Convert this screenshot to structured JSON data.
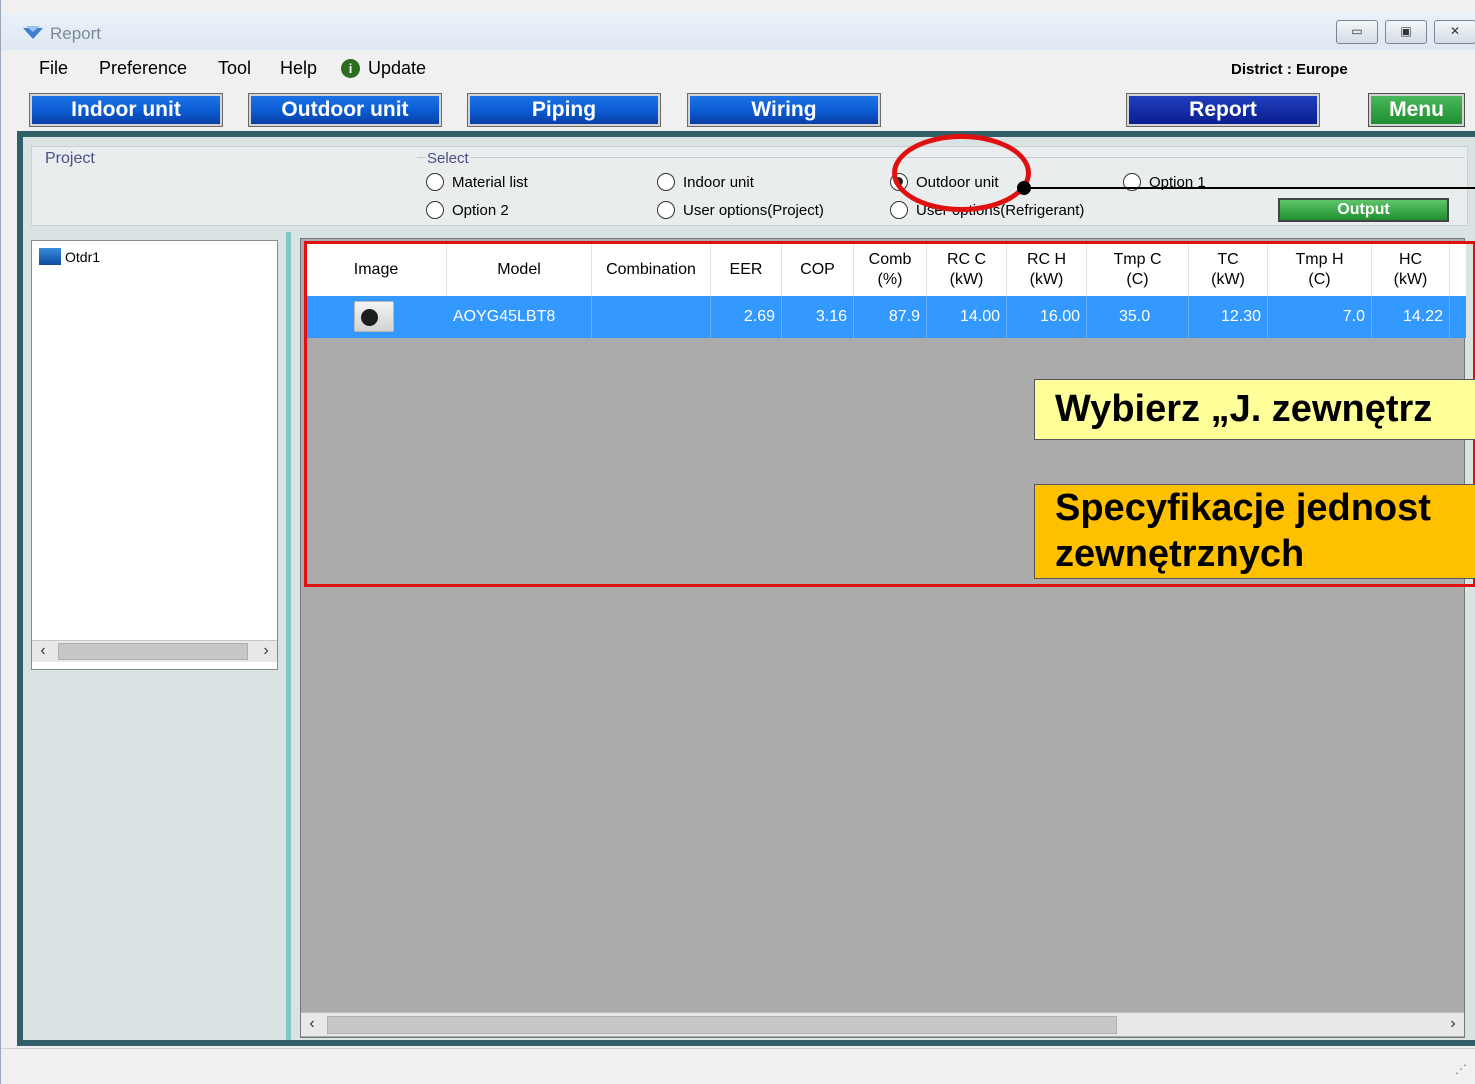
{
  "window": {
    "title": "Report",
    "controls": {
      "minimize": "▭",
      "maximize": "▣",
      "close": "✕"
    }
  },
  "menubar": {
    "items": [
      "File",
      "Preference",
      "Tool",
      "Help"
    ],
    "update_label": "Update",
    "update_icon": "info-icon",
    "district": "District : Europe"
  },
  "nav": {
    "indoor": "Indoor unit",
    "outdoor": "Outdoor unit",
    "piping": "Piping",
    "wiring": "Wiring",
    "report": "Report",
    "menu": "Menu"
  },
  "panel": {
    "project_label": "Project",
    "select_label": "Select",
    "radios": [
      {
        "label": "Material list",
        "checked": false
      },
      {
        "label": "Indoor unit",
        "checked": false
      },
      {
        "label": "Outdoor unit",
        "checked": true
      },
      {
        "label": "Option 1",
        "checked": false
      },
      {
        "label": "Option 2",
        "checked": false
      },
      {
        "label": "User options(Project)",
        "checked": false
      },
      {
        "label": "User options(Refrigerant)",
        "checked": false
      }
    ],
    "output_label": "Output"
  },
  "tree": {
    "items": [
      "Otdr1"
    ]
  },
  "table": {
    "headers": [
      "Image",
      "Model",
      "Combination",
      "EER",
      "COP",
      "Comb\n(%)",
      "RC C\n(kW)",
      "RC H\n(kW)",
      "Tmp C\n(C)",
      "TC\n(kW)",
      "Tmp H\n(C)",
      "HC\n(kW)"
    ],
    "rows": [
      {
        "model": "AOYG45LBT8",
        "combination": "",
        "eer": "2.69",
        "cop": "3.16",
        "comb": "87.9",
        "rc_c": "14.00",
        "rc_h": "16.00",
        "tmp_c": "35.0",
        "tc": "12.30",
        "tmp_h": "7.0",
        "hc": "14.22"
      }
    ]
  },
  "annotations": {
    "note1": "Wybierz „J. zewnętrz",
    "note2_line1": "Specyfikacje jednost",
    "note2_line2": "zewnętrznych"
  },
  "colors": {
    "accent_blue": "#0b5ad2",
    "selection": "#3399ff",
    "highlight_red": "#e01010"
  }
}
